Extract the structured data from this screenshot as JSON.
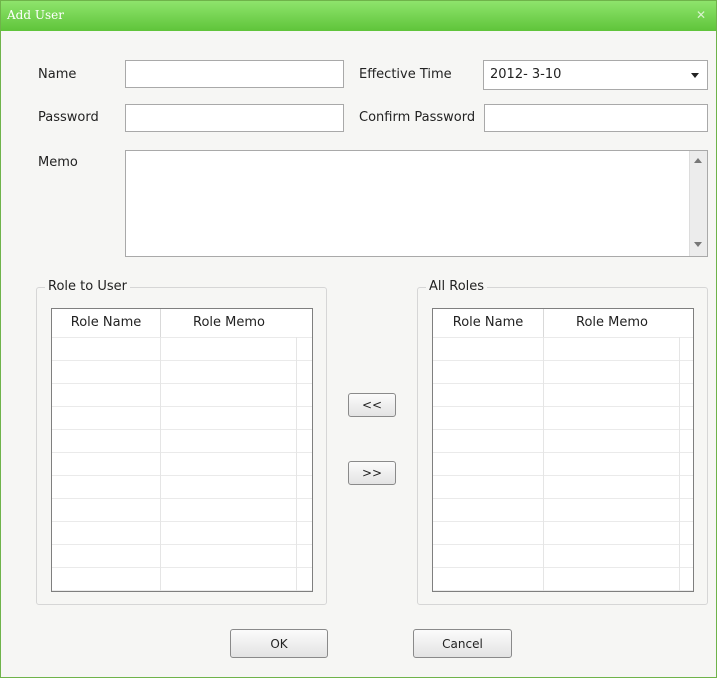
{
  "window": {
    "title": "Add User",
    "close_symbol": "✕"
  },
  "form": {
    "name_label": "Name",
    "name_value": "",
    "effective_time_label": "Effective Time",
    "effective_time_value": "2012-  3-10",
    "password_label": "Password",
    "password_value": "",
    "confirm_password_label": "Confirm Password",
    "confirm_password_value": "",
    "memo_label": "Memo",
    "memo_value": ""
  },
  "role_to_user": {
    "title": "Role to User",
    "columns": [
      "Role Name",
      "Role Memo"
    ],
    "rows": []
  },
  "all_roles": {
    "title": "All Roles",
    "columns": [
      "Role Name",
      "Role Memo"
    ],
    "rows": []
  },
  "transfer": {
    "add_label": "<<",
    "remove_label": ">>"
  },
  "buttons": {
    "ok_label": "OK",
    "cancel_label": "Cancel"
  },
  "colors": {
    "titlebar": "#6cd046",
    "border": "#6fb34a"
  }
}
